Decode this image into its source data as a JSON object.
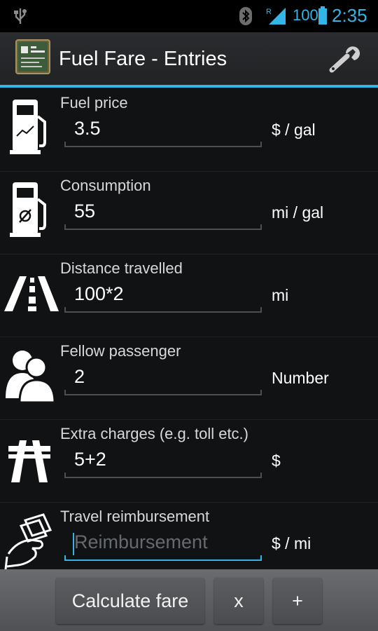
{
  "status_bar": {
    "battery": "100",
    "time": "2:35",
    "signal_label": "R"
  },
  "action_bar": {
    "title": "Fuel Fare - Entries"
  },
  "rows": [
    {
      "label": "Fuel price",
      "value": "3.5",
      "unit": "$ / gal",
      "icon": "fuel-price-icon"
    },
    {
      "label": "Consumption",
      "value": "55",
      "unit": "mi / gal",
      "icon": "consumption-icon"
    },
    {
      "label": "Distance travelled",
      "value": "100*2",
      "unit": "mi",
      "icon": "road-icon"
    },
    {
      "label": "Fellow passenger",
      "value": "2",
      "unit": "Number",
      "icon": "passengers-icon"
    },
    {
      "label": "Extra charges (e.g. toll etc.)",
      "value": "5+2",
      "unit": "$",
      "icon": "highway-icon"
    },
    {
      "label": "Travel reimbursement",
      "value": "",
      "placeholder": "Reimbursement",
      "unit": "$ / mi",
      "icon": "money-hand-icon"
    }
  ],
  "buttons": {
    "calculate": "Calculate fare",
    "clear": "x",
    "add": "+"
  },
  "colors": {
    "accent": "#33b5e5",
    "background": "#111214"
  }
}
